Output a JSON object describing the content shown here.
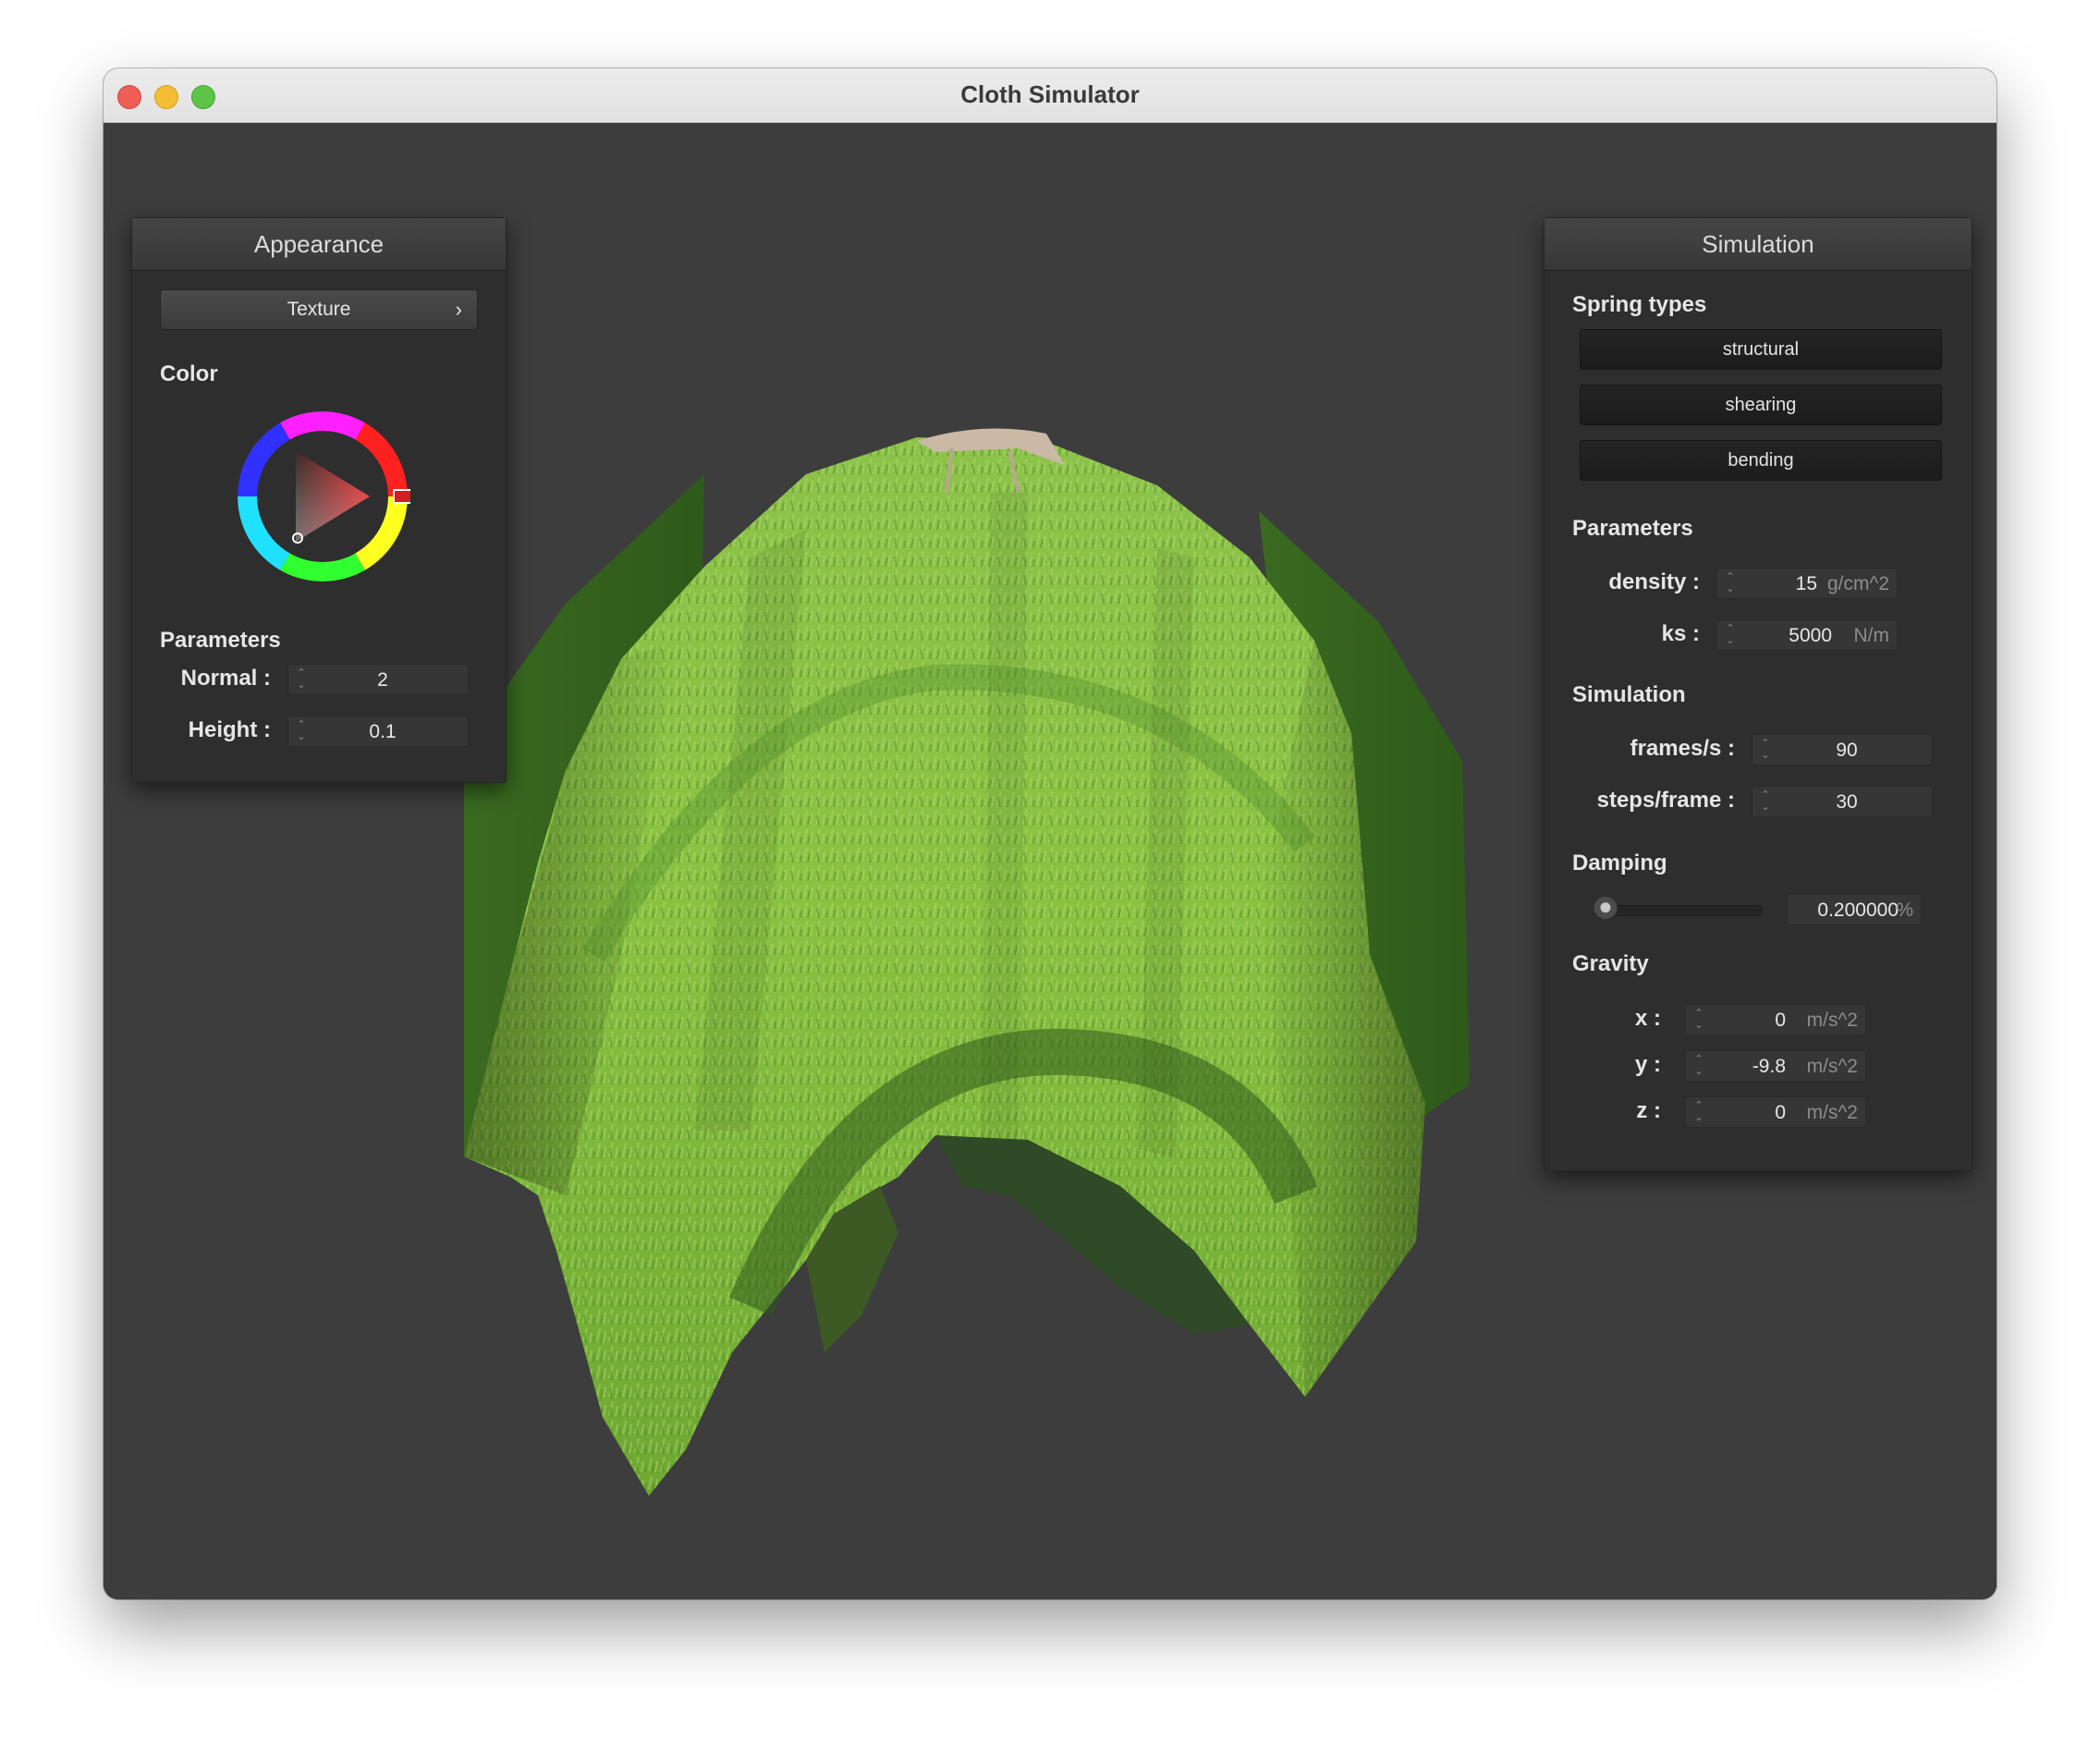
{
  "window": {
    "title": "Cloth Simulator"
  },
  "appearance": {
    "header": "Appearance",
    "texture_button": "Texture",
    "texture_chevron": "›",
    "color_label": "Color",
    "parameters_label": "Parameters",
    "normal_label": "Normal :",
    "normal_value": "2",
    "height_label": "Height :",
    "height_value": "0.1"
  },
  "simulation_panel": {
    "header": "Simulation",
    "spring_types_label": "Spring types",
    "spring_buttons": [
      "structural",
      "shearing",
      "bending"
    ],
    "parameters_label": "Parameters",
    "density_label": "density :",
    "density_value": "15",
    "density_unit": "g/cm^2",
    "ks_label": "ks :",
    "ks_value": "5000",
    "ks_unit": "N/m",
    "simulation_label": "Simulation",
    "fps_label": "frames/s :",
    "fps_value": "90",
    "steps_label": "steps/frame :",
    "steps_value": "30",
    "damping_label": "Damping",
    "damping_value": "0.200000",
    "damping_unit": "%",
    "gravity_label": "Gravity",
    "gx_label": "x :",
    "gx_value": "0",
    "gy_label": "y :",
    "gy_value": "-9.8",
    "gz_label": "z :",
    "gz_value": "0",
    "gravity_unit": "m/s^2"
  },
  "colors": {
    "viewport": "#3d3d3d",
    "panel": "#2e2e2e",
    "selected_color": "#e03030",
    "cloth_green": "#7fbf3a"
  }
}
